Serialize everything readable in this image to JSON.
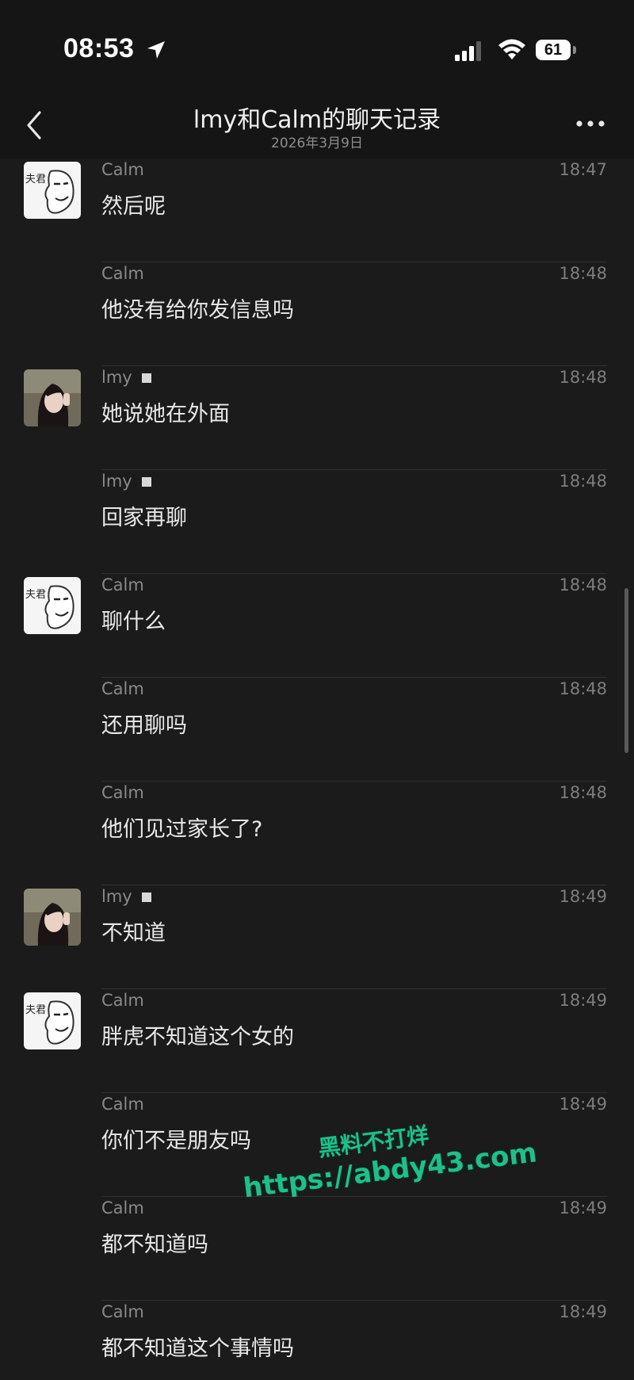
{
  "status_bar": {
    "time": "08:53",
    "battery": "61",
    "icons": [
      "location-arrow-icon",
      "signal-icon",
      "wifi-icon",
      "battery-icon"
    ]
  },
  "nav": {
    "title": "lmy和Calm的聊天记录",
    "subtitle": "2026年3月9日",
    "back_icon": "chevron-left-icon",
    "more_icon": "more-dots-icon"
  },
  "messages": [
    {
      "sender": "Calm",
      "time": "18:47",
      "text": "然后呢",
      "avatar": "calm"
    },
    {
      "sender": "Calm",
      "time": "18:48",
      "text": "他没有给你发信息吗",
      "avatar": ""
    },
    {
      "sender": "lmy",
      "time": "18:48",
      "text": "她说她在外面",
      "avatar": "lmy"
    },
    {
      "sender": "lmy",
      "time": "18:48",
      "text": "回家再聊",
      "avatar": ""
    },
    {
      "sender": "Calm",
      "time": "18:48",
      "text": "聊什么",
      "avatar": "calm"
    },
    {
      "sender": "Calm",
      "time": "18:48",
      "text": "还用聊吗",
      "avatar": ""
    },
    {
      "sender": "Calm",
      "time": "18:48",
      "text": "他们见过家长了?",
      "avatar": ""
    },
    {
      "sender": "lmy",
      "time": "18:49",
      "text": "不知道",
      "avatar": "lmy"
    },
    {
      "sender": "Calm",
      "time": "18:49",
      "text": "胖虎不知道这个女的",
      "avatar": "calm"
    },
    {
      "sender": "Calm",
      "time": "18:49",
      "text": "你们不是朋友吗",
      "avatar": ""
    },
    {
      "sender": "Calm",
      "time": "18:49",
      "text": "都不知道吗",
      "avatar": ""
    },
    {
      "sender": "Calm",
      "time": "18:49",
      "text": "都不知道这个事情吗",
      "avatar": ""
    }
  ],
  "avatar_text": {
    "calm": "夫君"
  },
  "watermark": {
    "line1": "黑料不打烊",
    "line2": "https://abdy43.com"
  },
  "colors": {
    "background": "#1b1b1b",
    "header": "#151515",
    "watermark": "#1fbf8a"
  }
}
